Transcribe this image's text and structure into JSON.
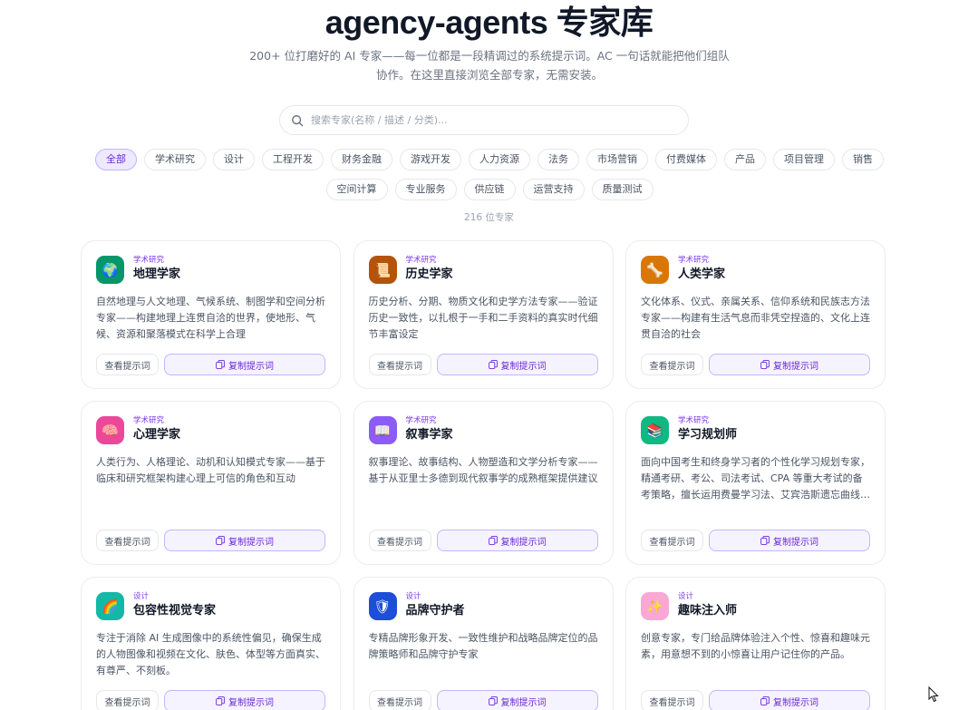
{
  "header": {
    "title": "agency-agents 专家库",
    "subtitle": "200+ 位打磨好的 AI 专家——每一位都是一段精调过的系统提示词。AC 一句话就能把他们组队协作。在这里直接浏览全部专家，无需安装。"
  },
  "search": {
    "placeholder": "搜索专家(名称 / 描述 / 分类)..."
  },
  "filters": [
    {
      "label": "全部",
      "active": true
    },
    {
      "label": "学术研究",
      "active": false
    },
    {
      "label": "设计",
      "active": false
    },
    {
      "label": "工程开发",
      "active": false
    },
    {
      "label": "财务金融",
      "active": false
    },
    {
      "label": "游戏开发",
      "active": false
    },
    {
      "label": "人力资源",
      "active": false
    },
    {
      "label": "法务",
      "active": false
    },
    {
      "label": "市场营销",
      "active": false
    },
    {
      "label": "付费媒体",
      "active": false
    },
    {
      "label": "产品",
      "active": false
    },
    {
      "label": "项目管理",
      "active": false
    },
    {
      "label": "销售",
      "active": false
    },
    {
      "label": "空间计算",
      "active": false
    },
    {
      "label": "专业服务",
      "active": false
    },
    {
      "label": "供应链",
      "active": false
    },
    {
      "label": "运营支持",
      "active": false
    },
    {
      "label": "质量测试",
      "active": false
    }
  ],
  "count_label": "216 位专家",
  "actions": {
    "view_label": "查看提示词",
    "copy_label": "复制提示词"
  },
  "cards": [
    {
      "category": "学术研究",
      "name": "地理学家",
      "icon": "globe-icon",
      "glyph": "🌍",
      "color": "#059669",
      "desc": "自然地理与人文地理、气候系统、制图学和空间分析专家——构建地理上连贯自洽的世界，使地形、气候、资源和聚落模式在科学上合理"
    },
    {
      "category": "学术研究",
      "name": "历史学家",
      "icon": "scroll-icon",
      "glyph": "📜",
      "color": "#b45309",
      "desc": "历史分析、分期、物质文化和史学方法专家——验证历史一致性，以扎根于一手和二手资料的真实时代细节丰富设定"
    },
    {
      "category": "学术研究",
      "name": "人类学家",
      "icon": "bone-icon",
      "glyph": "🦴",
      "color": "#d97706",
      "desc": "文化体系、仪式、亲属关系、信仰系统和民族志方法专家——构建有生活气息而非凭空捏造的、文化上连贯自洽的社会"
    },
    {
      "category": "学术研究",
      "name": "心理学家",
      "icon": "brain-icon",
      "glyph": "🧠",
      "color": "#ec4899",
      "desc": "人类行为、人格理论、动机和认知模式专家——基于临床和研究框架构建心理上可信的角色和互动"
    },
    {
      "category": "学术研究",
      "name": "叙事学家",
      "icon": "book-icon",
      "glyph": "📖",
      "color": "#8b5cf6",
      "desc": "叙事理论、故事结构、人物塑造和文学分析专家——基于从亚里士多德到现代叙事学的成熟框架提供建议"
    },
    {
      "category": "学术研究",
      "name": "学习规划师",
      "icon": "books-icon",
      "glyph": "📚",
      "color": "#10b981",
      "desc": "面向中国考生和终身学习者的个性化学习规划专家，精通考研、考公、司法考试、CPA 等重大考试的备考策略，擅长运用费曼学习法、艾宾浩斯遗忘曲线、番茄钟等科学方法，帮助学习者制定高效的学习计划"
    },
    {
      "category": "设计",
      "name": "包容性视觉专家",
      "icon": "rainbow-icon",
      "glyph": "🌈",
      "color": "#14b8a6",
      "desc": "专注于消除 AI 生成图像中的系统性偏见，确保生成的人物图像和视频在文化、肤色、体型等方面真实、有尊严、不刻板。"
    },
    {
      "category": "设计",
      "name": "品牌守护者",
      "icon": "shield-icon",
      "glyph": "🛡",
      "color": "#1d4ed8",
      "desc": "专精品牌形象开发、一致性维护和战略品牌定位的品牌策略师和品牌守护专家"
    },
    {
      "category": "设计",
      "name": "趣味注入师",
      "icon": "sparkle-icon",
      "glyph": "✨",
      "color": "#f9a8d4",
      "desc": "创意专家，专门给品牌体验注入个性、惊喜和趣味元素，用意想不到的小惊喜让用户记住你的产品。"
    }
  ]
}
